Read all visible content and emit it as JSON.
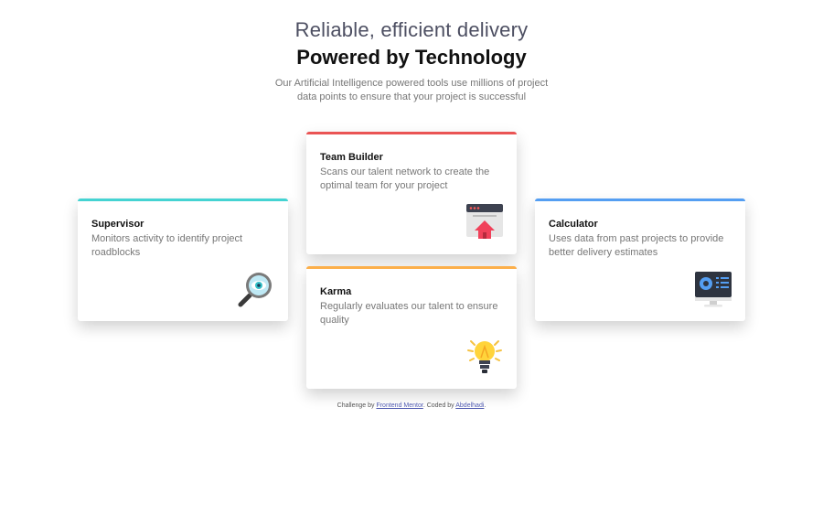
{
  "header": {
    "headline_light": "Reliable, efficient delivery",
    "headline_bold": "Powered by Technology",
    "intro": "Our Artificial Intelligence powered tools use millions of project data points to ensure that your project is successful"
  },
  "cards": [
    {
      "title": "Supervisor",
      "description": "Monitors activity to identify project roadblocks",
      "icon": "magnifier-eye-icon",
      "accent": "#44d3d2"
    },
    {
      "title": "Team Builder",
      "description": "Scans our talent network to create the optimal team for your project",
      "icon": "team-builder-icon",
      "accent": "#ea5454"
    },
    {
      "title": "Karma",
      "description": "Regularly evaluates our talent to ensure quality",
      "icon": "lightbulb-icon",
      "accent": "#fcaf4a"
    },
    {
      "title": "Calculator",
      "description": "Uses data from past projects to provide better delivery estimates",
      "icon": "monitor-calculator-icon",
      "accent": "#549ef2"
    }
  ],
  "footer": {
    "prefix": "Challenge by ",
    "link1": "Frontend Mentor",
    "middle": ". Coded by ",
    "link2": "Abdelhadi",
    "suffix": "."
  }
}
